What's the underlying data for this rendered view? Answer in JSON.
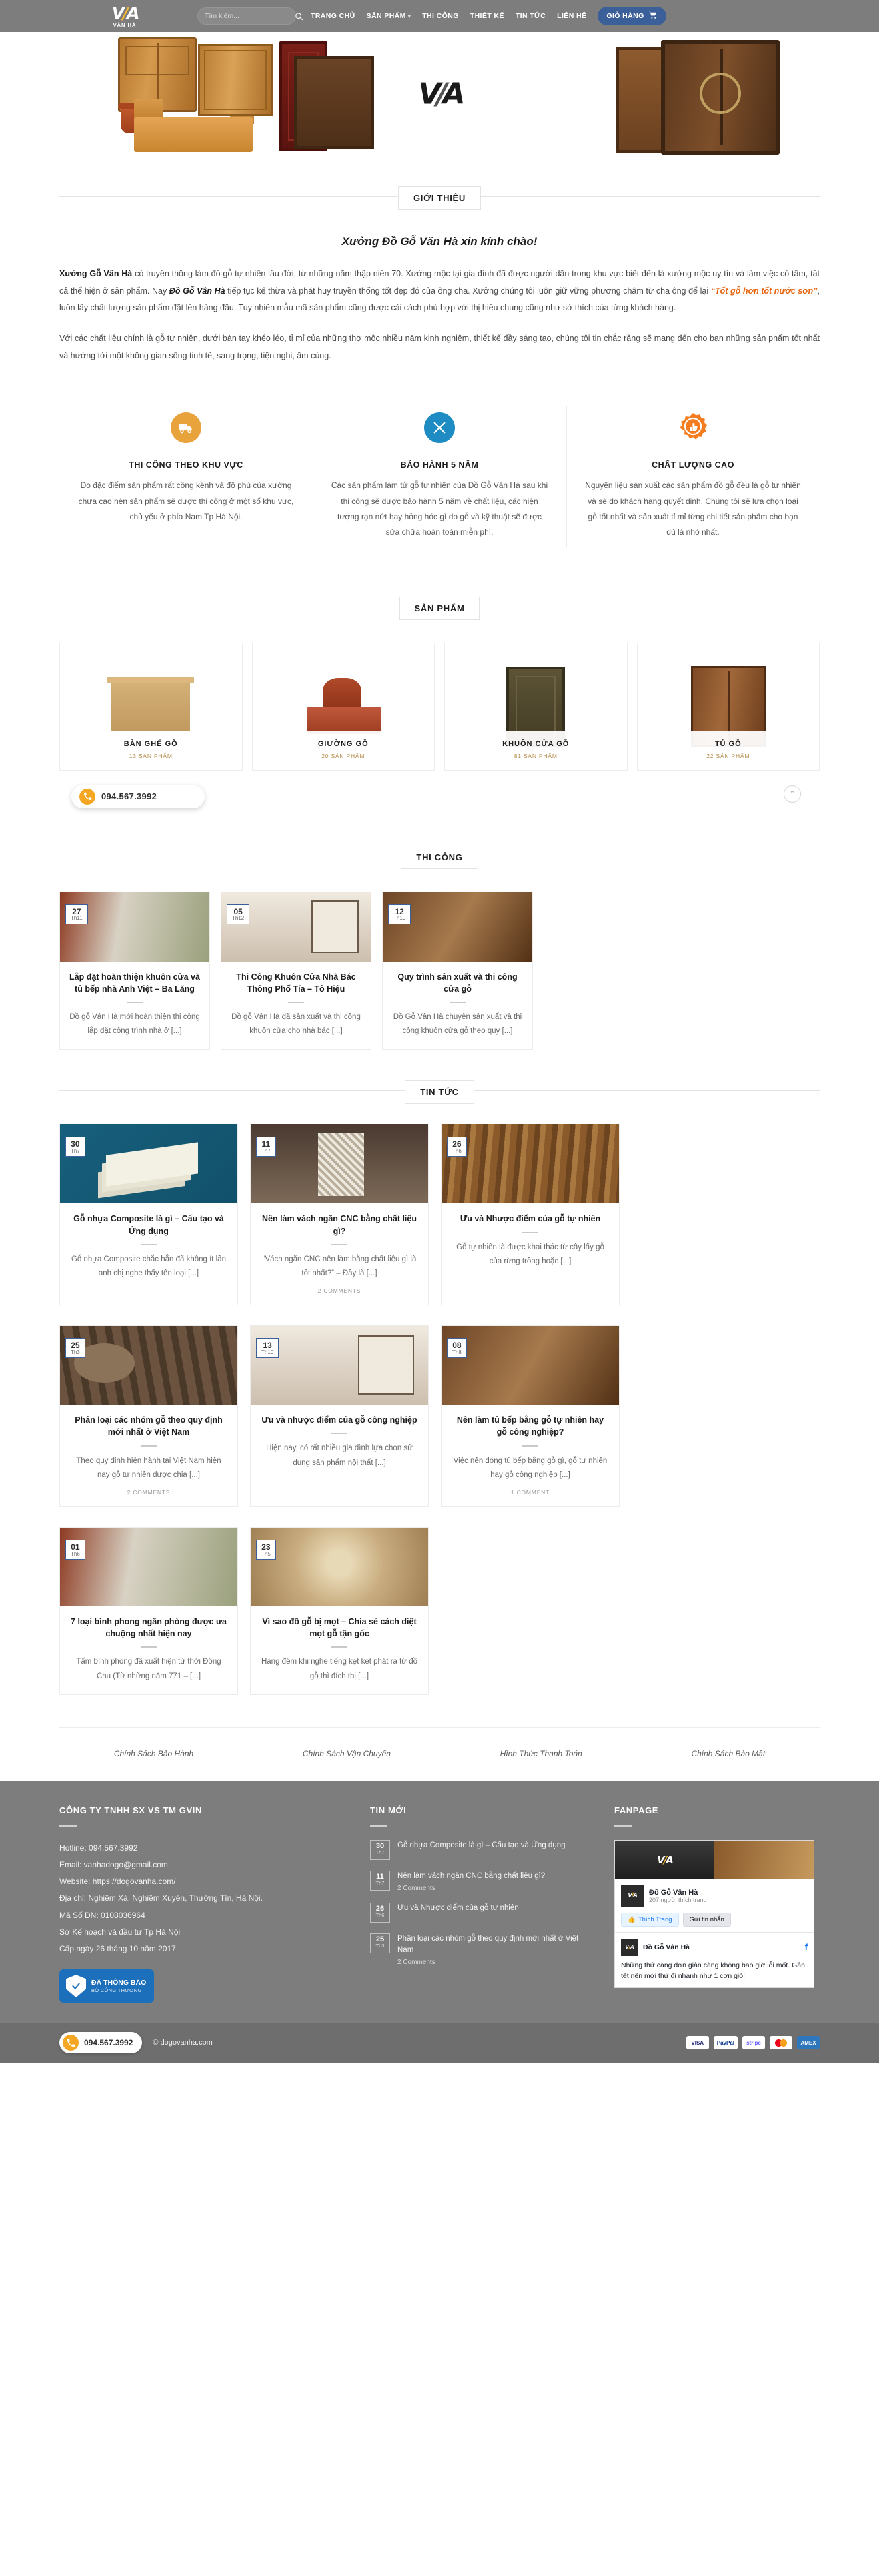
{
  "header": {
    "logo_main": "V/A",
    "logo_sub": "VÂN HÀ",
    "search_placeholder": "Tìm kiếm...",
    "nav": [
      {
        "label": "TRANG CHỦ",
        "has_caret": false
      },
      {
        "label": "SẢN PHẨM",
        "has_caret": true
      },
      {
        "label": "THI CÔNG",
        "has_caret": false
      },
      {
        "label": "THIẾT KẾ",
        "has_caret": false
      },
      {
        "label": "TIN TỨC",
        "has_caret": false
      },
      {
        "label": "LIÊN HỆ",
        "has_caret": false
      }
    ],
    "cart_label": "GIỎ HÀNG",
    "cart_color": "#3b6099"
  },
  "hero": {
    "watermark": "V/A"
  },
  "intro": {
    "section_title": "GIỚI THIỆU",
    "heading": "Xưởng Đồ Gỗ Văn Hà xin kính chào!",
    "p1_a": "Xưởng Gỗ Vân Hà",
    "p1_b": " có truyền thống làm đồ gỗ tự nhiên lâu đời, từ những năm thập niên 70. Xưởng mộc tại gia đình đã được người dân trong khu vực biết đến là xưởng mộc uy tín và làm việc có tâm, tất cả thể hiện ở sản phẩm. Nay ",
    "p1_c": "Đồ Gỗ Vân Hà",
    "p1_d": " tiếp tục kế thừa và phát huy truyền thống tốt đẹp đó của ông cha. Xưởng chúng tôi luôn giữ vững phương châm từ cha ông để lại ",
    "p1_quote": "“Tốt gỗ hơn tốt nước sơn”",
    "p1_e": ", luôn lấy chất lượng sản phẩm đặt lên hàng đầu. Tuy nhiên mẫu mã sản phẩm cũng được cải cách phù hợp với thị hiếu chung cũng như sở thích của từng khách hàng.",
    "p2": "Với các chất liệu chính là gỗ tự nhiên, dưới bàn tay khéo léo, tỉ mỉ của những thợ mộc nhiều năm kinh nghiệm, thiết kế đầy sáng tạo, chúng tôi tin chắc rằng sẽ mang đến cho bạn những sản phẩm tốt nhất và hướng tới một không gian sống tinh tế, sang trọng, tiện nghi, ấm cúng."
  },
  "features": [
    {
      "icon": "truck-icon",
      "color": "#e8a33d",
      "title": "THI CÔNG THEO KHU VỰC",
      "text": "Do đặc điểm sản phẩm rất cồng kềnh và độ phủ của xưởng chưa cao nên sản phẩm sẽ được thi công ở một số khu vực, chủ yếu ở phía Nam Tp Hà Nội."
    },
    {
      "icon": "tools-icon",
      "color": "#1e8bc3",
      "title": "BẢO HÀNH 5 NĂM",
      "text": "Các sản phẩm làm từ gỗ tự nhiên của Đồ Gỗ Vân Hà sau khi thi công sẽ được bảo hành 5 năm về chất liệu, các hiện tượng rạn nứt hay hỏng hóc gì do gỗ và kỹ thuật sẽ được sửa chữa hoàn toàn miễn phí."
    },
    {
      "icon": "award-icon",
      "color": "#f57c1f",
      "title": "CHẤT LƯỢNG CAO",
      "text": "Nguyên liệu sản xuất các sản phẩm đồ gỗ đều là gỗ tự nhiên và sẽ do khách hàng quyết định. Chúng tôi sẽ lựa chọn loại gỗ tốt nhất và sản xuất tỉ mỉ từng chi tiết sản phẩm cho bạn dù là nhỏ nhất."
    }
  ],
  "products": {
    "section_title": "SẢN PHẨM",
    "items": [
      {
        "name": "BÀN GHẾ GỖ",
        "count": "13 SẢN PHẨM",
        "art": "desk"
      },
      {
        "name": "GIƯỜNG GỖ",
        "count": "20 SẢN PHẨM",
        "art": "bed"
      },
      {
        "name": "KHUÔN CỬA GỖ",
        "count": "81 SẢN PHẨM",
        "art": "door"
      },
      {
        "name": "TỦ GỖ",
        "count": "22 SẢN PHẨM",
        "art": "wardrobe"
      }
    ]
  },
  "construction": {
    "section_title": "THI CÔNG",
    "items": [
      {
        "day": "27",
        "month": "Th11",
        "title": "Lắp đặt hoàn thiện khuôn cửa và tủ bếp nhà Anh Việt – Ba Lăng",
        "excerpt": "Đồ gỗ Vân Hà mới hoàn thiện thi công lắp đặt công trình nhà ở [...]",
        "thumb": "th-7"
      },
      {
        "day": "05",
        "month": "Th12",
        "title": "Thi Công Khuôn Cửa Nhà Bác Thông Phố Tía – Tô Hiệu",
        "excerpt": "Đồ gỗ Vân Hà đã sản xuất và thi công khuôn cửa cho nhà bác [...]",
        "thumb": "th-5"
      },
      {
        "day": "12",
        "month": "Th10",
        "title": "Quy trình sản xuất và thi công cửa gỗ",
        "excerpt": "Đồ Gỗ Vân Hà chuyên sản xuất và thi công khuôn cửa gỗ theo quy [...]",
        "thumb": "th-6"
      }
    ]
  },
  "news": {
    "section_title": "TIN TỨC",
    "rows": [
      [
        {
          "day": "30",
          "month": "Th7",
          "title": "Gỗ nhựa Composite là gì – Cấu tạo và Ứng dụng",
          "excerpt": "Gỗ nhựa Composite chắc hẳn đã không ít lần anh chị nghe thấy tên loại [...]",
          "comments": "",
          "thumb": "th-1"
        },
        {
          "day": "11",
          "month": "Th7",
          "title": "Nên làm vách ngăn CNC bằng chất liệu gì?",
          "excerpt": "“Vách ngăn CNC nên làm bằng chất liệu gì là tốt nhất?” – Đây là [...]",
          "comments": "2 COMMENTS",
          "thumb": "th-2"
        },
        {
          "day": "26",
          "month": "Th6",
          "title": "Ưu và Nhược điểm của gỗ tự nhiên",
          "excerpt": "Gỗ tự nhiên là được khai thác từ cây lấy gỗ của rừng trồng hoặc [...]",
          "comments": "",
          "thumb": "th-3"
        }
      ],
      [
        {
          "day": "25",
          "month": "Th3",
          "title": "Phân loại các nhóm gỗ theo quy định mới nhất ở Việt Nam",
          "excerpt": "Theo quy định hiện hành tại Việt Nam hiện nay gỗ tự nhiên được chia [...]",
          "comments": "2 COMMENTS",
          "thumb": "th-4"
        },
        {
          "day": "13",
          "month": "Th10",
          "title": "Ưu và nhược điểm của gỗ công nghiệp",
          "excerpt": "Hiện nay, có rất nhiều gia đình lựa chọn sử dụng sản phẩm nội thất [...]",
          "comments": "",
          "thumb": "th-5"
        },
        {
          "day": "08",
          "month": "Th8",
          "title": "Nên làm tủ bếp bằng gỗ tự nhiên hay gỗ công nghiệp?",
          "excerpt": "Việc nên đóng tủ bếp bằng gỗ gì, gỗ tự nhiên hay gỗ công nghiệp [...]",
          "comments": "1 COMMENT",
          "thumb": "th-6"
        }
      ],
      [
        {
          "day": "01",
          "month": "Th6",
          "title": "7 loại bình phong ngăn phòng được ưa chuộng nhất hiện nay",
          "excerpt": "Tấm bình phong đã xuất hiện từ thời Đông Chu (Từ những năm 771 – [...]",
          "comments": "",
          "thumb": "th-7"
        },
        {
          "day": "23",
          "month": "Th5",
          "title": "Vì sao đồ gỗ bị mọt – Chia sẻ cách diệt mọt gỗ tận gốc",
          "excerpt": "Hàng đêm khi nghe tiếng kẹt kẹt phát ra từ đồ gỗ thì đích thị [...]",
          "comments": "",
          "thumb": "th-8"
        }
      ]
    ]
  },
  "hotline_float": {
    "number": "094.567.3992",
    "icon": "phone-icon"
  },
  "scroll_top": {
    "icon": "chevron-up-icon"
  },
  "policy_links": [
    "Chính Sách Bảo Hành",
    "Chính Sách Vận Chuyển",
    "Hình Thức Thanh Toán",
    "Chính Sách Bảo Mật"
  ],
  "footer": {
    "company": {
      "title": "CÔNG TY TNHH SX VS TM GVIN",
      "lines": [
        "Hotline: 094.567.3992",
        "Email: vanhadogo@gmail.com",
        "Website: https://dogovanha.com/",
        "Địa chỉ: Nghiêm Xá, Nghiêm Xuyên, Thường Tín, Hà Nội.",
        "Mã Số DN: 0108036964",
        "Sở Kế hoạch và đầu tư Tp Hà Nội",
        "Cấp ngày 26 tháng 10 năm 2017"
      ],
      "badge_line1": "ĐÃ THÔNG BÁO",
      "badge_line2": "BỘ CÔNG THƯƠNG"
    },
    "recent": {
      "title": "TIN MỚI",
      "items": [
        {
          "day": "30",
          "month": "Th7",
          "title": "Gỗ nhựa Composite là gì – Cấu tạo và Ứng dụng",
          "comments": ""
        },
        {
          "day": "11",
          "month": "Th7",
          "title": "Nên làm vách ngăn CNC bằng chất liệu gì?",
          "comments": "2 Comments"
        },
        {
          "day": "26",
          "month": "Th6",
          "title": "Ưu và Nhược điểm của gỗ tự nhiên",
          "comments": ""
        },
        {
          "day": "25",
          "month": "Th3",
          "title": "Phân loại các nhóm gỗ theo quy định mới nhất ở Việt Nam",
          "comments": "2 Comments"
        }
      ]
    },
    "fanpage": {
      "title": "FANPAGE",
      "page_name": "Đồ Gỗ Vân Hà",
      "page_likes": "207 người thích trang",
      "like_label": "Thích Trang",
      "share_label": "Gửi tin nhắn",
      "post_name": "Đồ Gỗ Vân Hà",
      "post_text": "Những thứ càng đơn giản càng không bao giờ lỗi mốt. Gần tết nên mới thứ đi nhanh như 1 cơn gió!"
    }
  },
  "bottombar": {
    "hotline": "094.567.3992",
    "copyright": "© dogovanha.com",
    "payments": [
      "VISA",
      "PayPal",
      "stripe",
      "mastercard",
      "amex"
    ]
  }
}
